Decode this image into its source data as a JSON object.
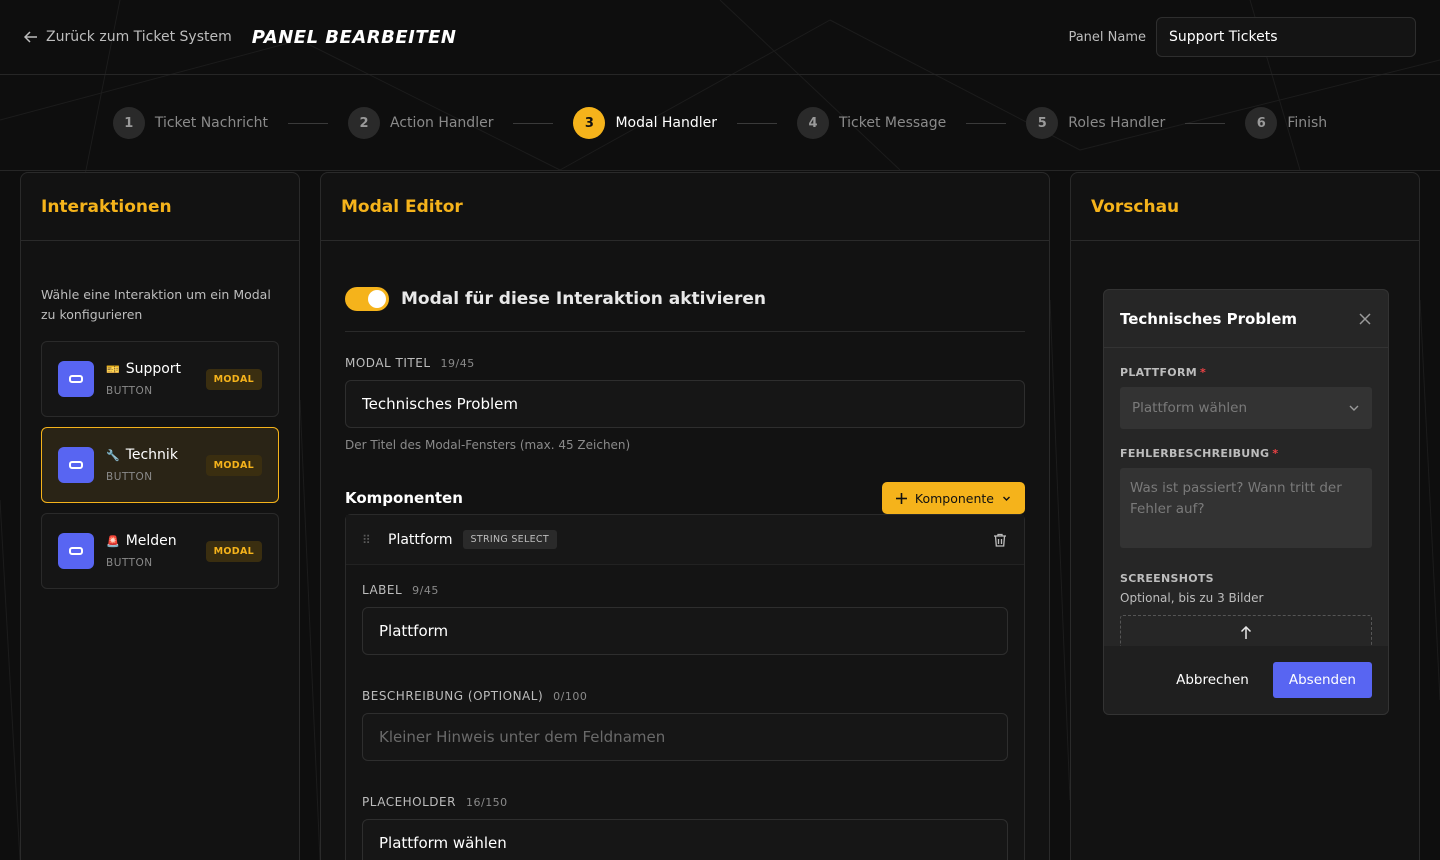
{
  "header": {
    "back_label": "Zurück zum Ticket System",
    "title": "PANEL BEARBEITEN",
    "panel_name_label": "Panel Name",
    "panel_name_value": "Support Tickets"
  },
  "steps": [
    {
      "num": "1",
      "label": "Ticket Nachricht"
    },
    {
      "num": "2",
      "label": "Action Handler"
    },
    {
      "num": "3",
      "label": "Modal Handler"
    },
    {
      "num": "4",
      "label": "Ticket Message"
    },
    {
      "num": "5",
      "label": "Roles Handler"
    },
    {
      "num": "6",
      "label": "Finish"
    }
  ],
  "active_step": 3,
  "left": {
    "title": "Interaktionen",
    "hint": "Wähle eine Interaktion um ein Modal zu konfigurieren",
    "items": [
      {
        "emoji": "🎫",
        "name": "Support",
        "type": "BUTTON",
        "badge": "MODAL"
      },
      {
        "emoji": "🔧",
        "name": "Technik",
        "type": "BUTTON",
        "badge": "MODAL"
      },
      {
        "emoji": "🚨",
        "name": "Melden",
        "type": "BUTTON",
        "badge": "MODAL"
      }
    ]
  },
  "mid": {
    "title": "Modal Editor",
    "toggle_label": "Modal für diese Interaktion aktivieren",
    "modal_title_label": "MODAL TITEL",
    "modal_title_count": "19/45",
    "modal_title_value": "Technisches Problem",
    "modal_title_help": "Der Titel des Modal-Fensters (max. 45 Zeichen)",
    "components_title": "Komponenten",
    "add_component_label": "Komponente",
    "component": {
      "name": "Plattform",
      "badge": "STRING SELECT",
      "label_label": "LABEL",
      "label_count": "9/45",
      "label_value": "Plattform",
      "desc_label": "BESCHREIBUNG (OPTIONAL)",
      "desc_count": "0/100",
      "desc_placeholder": "Kleiner Hinweis unter dem Feldnamen",
      "placeholder_label": "PLACEHOLDER",
      "placeholder_count": "16/150",
      "placeholder_value": "Plattform wählen"
    }
  },
  "right": {
    "title": "Vorschau",
    "modal": {
      "title": "Technisches Problem",
      "field1_label": "PLATTFORM",
      "field1_placeholder": "Plattform wählen",
      "field2_label": "FEHLERBESCHREIBUNG",
      "field2_placeholder": "Was ist passiert? Wann tritt der Fehler auf?",
      "field3_label": "SCREENSHOTS",
      "field3_sub": "Optional, bis zu 3 Bilder",
      "required_mark": "*",
      "cancel_label": "Abbrechen",
      "submit_label": "Absenden"
    }
  },
  "colors": {
    "accent": "#f5b31b",
    "discord_blurple": "#5865f2",
    "required": "#ed4245"
  }
}
